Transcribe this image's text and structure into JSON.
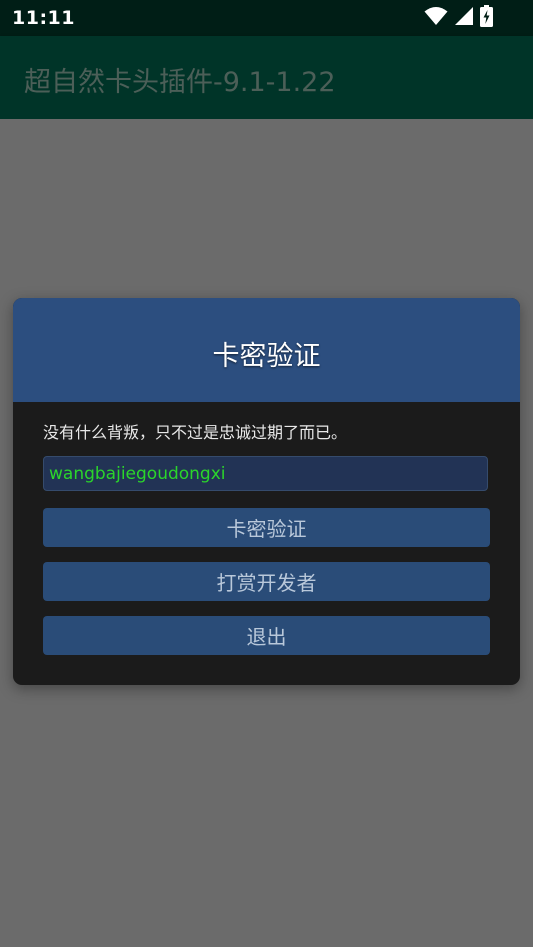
{
  "status_bar": {
    "time": "11:11",
    "icons": [
      "wifi-icon",
      "signal-icon",
      "battery-charging-icon"
    ]
  },
  "app_bar": {
    "title": "超自然卡头插件-9.1-1.22"
  },
  "dialog": {
    "title": "卡密验证",
    "message": "没有什么背叛，只不过是忠诚过期了而已。",
    "input_value": "wangbajiegoudongxi",
    "buttons": {
      "verify": "卡密验证",
      "donate": "打赏开发者",
      "exit": "退出"
    }
  },
  "colors": {
    "status_bar": "#001e16",
    "app_bar": "#003428",
    "scrim": "#6b6b6b",
    "dialog_header": "#2c4e7f",
    "dialog_body": "#1b1b1b",
    "button": "#2a4c78",
    "input_text": "#2bd52b"
  }
}
